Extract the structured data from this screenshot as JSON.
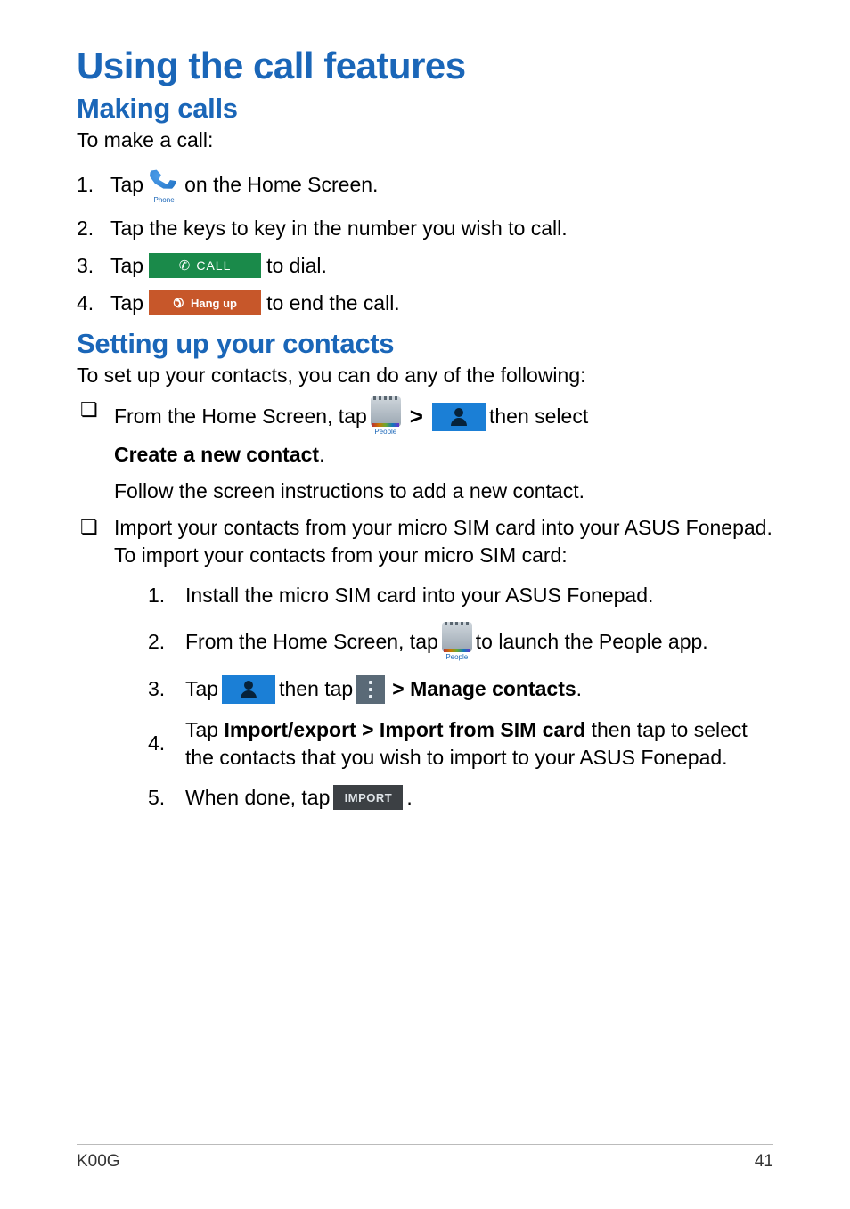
{
  "headings": {
    "h1": "Using the call features",
    "h2a": "Making calls",
    "h2b": "Setting up your contacts"
  },
  "intro": {
    "make_call": "To make a call:",
    "set_contacts": "To set up your contacts, you can do any of the following:"
  },
  "steps_call": {
    "n1": "1.",
    "n2": "2.",
    "n3": "3.",
    "n4": "4.",
    "s1a": "Tap ",
    "s1b": " on the Home Screen.",
    "s2": "Tap the keys to key in the number you wish to call.",
    "s3a": "Tap ",
    "s3b": " to dial.",
    "s4a": "Tap ",
    "s4b": " to end the call."
  },
  "icons": {
    "phone_label": "Phone",
    "call_label": "CALL",
    "hangup_label": "Hang up",
    "people_label": "People",
    "import_label": "IMPORT"
  },
  "contacts": {
    "b1a": "From the Home Screen, tap ",
    "b1_sep": ">",
    "b1b": " then select ",
    "b1_bold": "Create a new contact",
    "b1c": ". ",
    "b1_follow": "Follow the screen instructions to add a new contact.",
    "b2a": "Import your contacts from your micro SIM card into your ASUS Fonepad. To import your contacts from your micro SIM card:",
    "sub": {
      "n1": "1.",
      "n2": "2.",
      "n3": "3.",
      "n4": "4.",
      "n5": "5.",
      "s1": "Install the micro SIM card into your ASUS Fonepad.",
      "s2a": "From the Home Screen, tap ",
      "s2b": " to launch the People app.",
      "s3a": "Tap ",
      "s3b": " then tap ",
      "s3_sep": "> ",
      "s3_bold": "Manage contacts",
      "s3c": ".",
      "s4a": "Tap ",
      "s4_bold": "Import/export > Import from SIM card",
      "s4b": " then tap to select the contacts that you wish to import to your ASUS Fonepad.",
      "s5a": "When done, tap ",
      "s5b": "."
    }
  },
  "footer": {
    "left": "K00G",
    "right": "41"
  }
}
